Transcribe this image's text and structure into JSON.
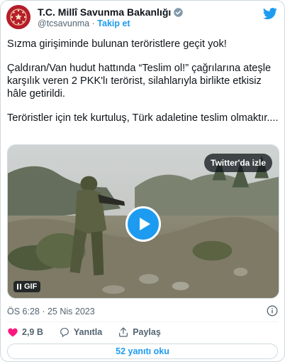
{
  "account": {
    "name": "T.C. Millî Savunma Bakanlığı",
    "handle": "@tcsavunma",
    "separator": "·",
    "follow_label": "Takip et"
  },
  "tweet": {
    "paragraphs": [
      "Sızma girişiminde bulunan teröristlere geçit yok!",
      "Çaldıran/Van hudut hattında “Teslim ol!” çağrılarına ateşle karşılık veren 2 PKK'lı terörist, silahlarıyla birlikte etkisiz hâle getirildi.",
      "Teröristler için tek kurtuluş, Türk adaletine teslim olmaktır...."
    ]
  },
  "media": {
    "watch_label": "Twitter'da izle",
    "gif_label": "GIF"
  },
  "meta": {
    "timestamp": "ÖS 6:28 · 25 Nis 2023"
  },
  "actions": {
    "likes": "2,9 B",
    "reply_label": "Yanıtla",
    "share_label": "Paylaş"
  },
  "replies_button": "52 yanıtı oku",
  "colors": {
    "accent": "#1d9bf0",
    "like": "#f91880",
    "text": "#0f1419",
    "muted": "#536471"
  },
  "icons": [
    "emblem-avatar",
    "verified-badge-icon",
    "twitter-bird-icon",
    "play-icon",
    "pause-icon",
    "info-icon",
    "heart-icon",
    "reply-icon",
    "share-icon"
  ]
}
